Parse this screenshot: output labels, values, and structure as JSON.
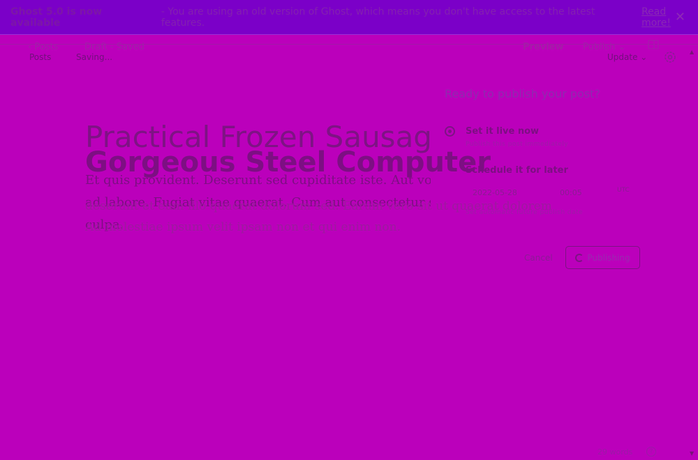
{
  "banner": {
    "strong": "Ghost 5.0 is now available",
    "message": "- You are using an old version of Ghost, which means you don't have access to the latest features.",
    "link": "Read more!"
  },
  "header": {
    "back_ghost": "‹ Posts",
    "status_ghost": "Draft - Saved",
    "back": "Posts",
    "status": "Saving...",
    "preview": "Preview",
    "publish": "Publish ⌄",
    "update": "Update ⌄"
  },
  "editor": {
    "title_light": "Practical Frozen Sausage",
    "title_bold": "Gorgeous Steel Computer",
    "line1": "Et quis provident. Deserunt sed cupiditate iste. Aut voluptate",
    "line2": "ad labore. Fugiat vitae quaerat. Cum aut consectetur sint",
    "line3": "culpa.",
    "overlay1": "deserunt et eum illo quaerat dolorum sed. Earum vero sit ut quaerat dolorem",
    "overlay2": "Ad molestiae ipsum velit ipsam non et qui enim non."
  },
  "popup": {
    "title": "Ready to publish your post?",
    "option1_title": "Set it live now",
    "option1_sub": "Publish this post immediately",
    "option2_title": "Schedule it for later",
    "date": "2022-05-28",
    "time": "00:05",
    "tz": "UTC",
    "option2_sub": "Set automatic future publish date",
    "cancel": "Cancel",
    "button": "Publishing"
  },
  "footer": {
    "words": "29 words",
    "help": "?"
  }
}
